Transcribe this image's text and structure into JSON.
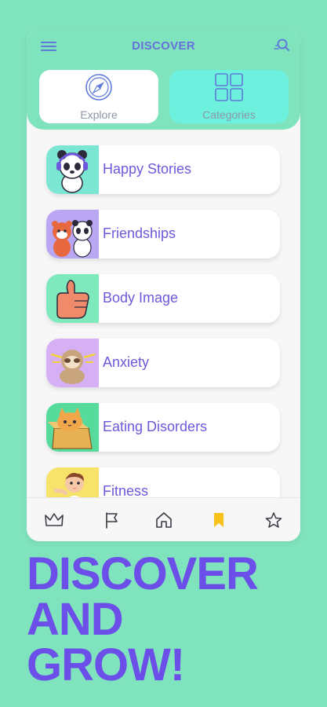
{
  "header": {
    "title": "DISCOVER"
  },
  "segments": [
    {
      "label": "Explore",
      "selected": false
    },
    {
      "label": "Categories",
      "selected": true
    }
  ],
  "categories": [
    {
      "label": "Happy Stories",
      "thumb_bg": "#7BE6D2",
      "icon": "panda-headphones-icon"
    },
    {
      "label": "Friendships",
      "thumb_bg": "#B9A7F4",
      "icon": "red-panda-and-panda-icon"
    },
    {
      "label": "Body Image",
      "thumb_bg": "#7FE9BE",
      "icon": "thumbs-up-icon"
    },
    {
      "label": "Anxiety",
      "thumb_bg": "#D6B0F4",
      "icon": "sloth-meditating-icon"
    },
    {
      "label": "Eating Disorders",
      "thumb_bg": "#57DB9C",
      "icon": "cat-in-box-icon"
    },
    {
      "label": "Fitness",
      "thumb_bg": "#F7E36A",
      "icon": "kid-exercising-icon"
    }
  ],
  "bottom_nav": [
    {
      "icon": "crown-icon",
      "active": false
    },
    {
      "icon": "flag-icon",
      "active": false
    },
    {
      "icon": "home-icon",
      "active": false
    },
    {
      "icon": "bookmark-icon",
      "active": true
    },
    {
      "icon": "star-icon",
      "active": false
    }
  ],
  "headline": {
    "line1": "DISCOVER",
    "line2": "AND",
    "line3": "GROW!"
  },
  "colors": {
    "background": "#7FE3BD",
    "accent": "#6B4FE8",
    "active_tab": "#F9C21A",
    "selected_segment": "#6DF0DD"
  }
}
